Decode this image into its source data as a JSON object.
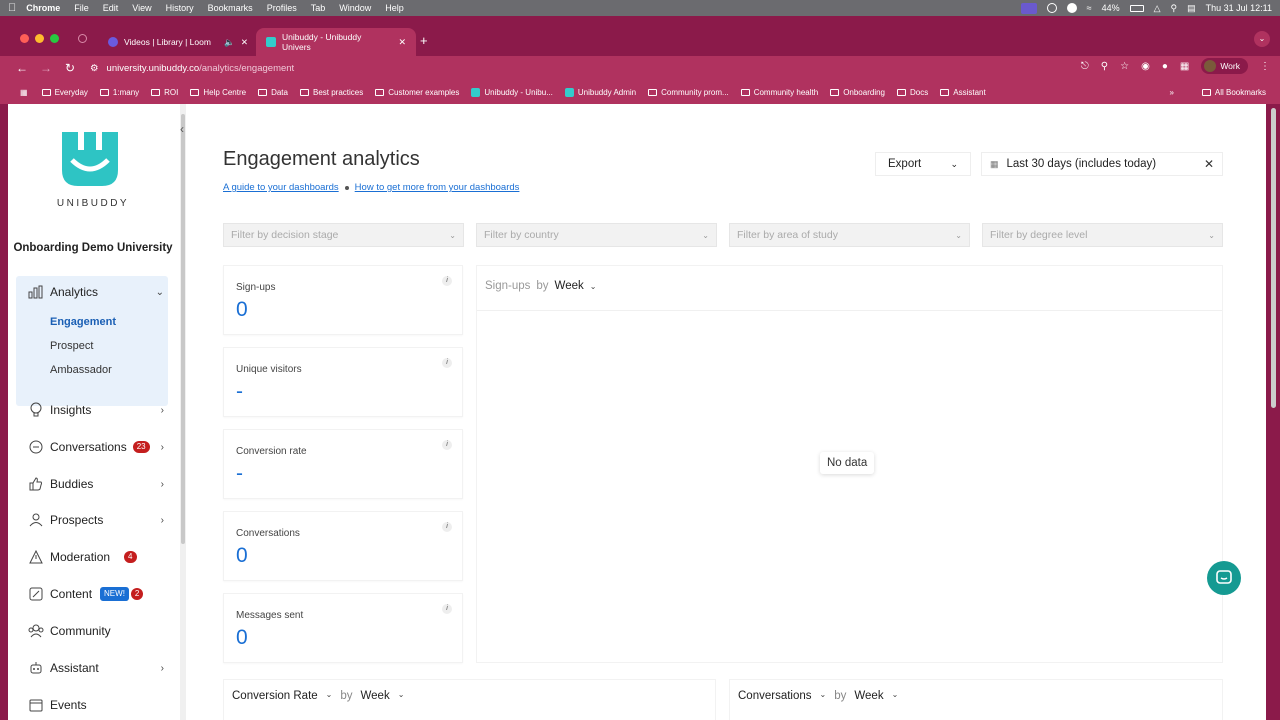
{
  "menubar": {
    "app": "Chrome",
    "items": [
      "File",
      "Edit",
      "View",
      "History",
      "Bookmarks",
      "Profiles",
      "Tab",
      "Window",
      "Help"
    ],
    "battery": "44%",
    "datetime": "Thu 31 Jul  12:11"
  },
  "tabs": [
    {
      "title": "Videos | Library | Loom",
      "active": false
    },
    {
      "title": "Unibuddy - Unibuddy Univers",
      "active": true
    }
  ],
  "toolbar": {
    "url_domain": "university.unibuddy.co",
    "url_path": "/analytics/engagement",
    "profile": "Work"
  },
  "bookmarks": {
    "items": [
      "Everyday",
      "1:many",
      "ROI",
      "Help Centre",
      "Data",
      "Best practices",
      "Customer examples",
      "Unibuddy - Unibu...",
      "Unibuddy Admin",
      "Community prom...",
      "Community health",
      "Onboarding",
      "Docs",
      "Assistant"
    ],
    "all": "All Bookmarks"
  },
  "sidebar": {
    "logo_text": "UNIBUDDY",
    "university": "Onboarding Demo University",
    "analytics": {
      "label": "Analytics",
      "sub": [
        "Engagement",
        "Prospect",
        "Ambassador"
      ]
    },
    "items": [
      {
        "label": "Insights",
        "icon": "lightbulb-icon",
        "badge": ""
      },
      {
        "label": "Conversations",
        "icon": "chat-icon",
        "badge": "23"
      },
      {
        "label": "Buddies",
        "icon": "thumbs-up-icon",
        "badge": ""
      },
      {
        "label": "Prospects",
        "icon": "person-icon",
        "badge": ""
      },
      {
        "label": "Moderation",
        "icon": "warning-icon",
        "badge": "4"
      },
      {
        "label": "Content",
        "icon": "edit-icon",
        "badge": "2",
        "tag": "NEW!"
      },
      {
        "label": "Community",
        "icon": "group-icon",
        "badge": ""
      },
      {
        "label": "Assistant",
        "icon": "robot-icon",
        "badge": ""
      },
      {
        "label": "Events",
        "icon": "calendar-icon",
        "badge": ""
      }
    ]
  },
  "main": {
    "title": "Engagement analytics",
    "link1": "A guide to your dashboards",
    "link2": "How to get more from your dashboards",
    "export": "Export",
    "date_range": "Last 30 days (includes today)",
    "filters": [
      "Filter by decision stage",
      "Filter by country",
      "Filter by area of study",
      "Filter by degree level"
    ],
    "metrics": [
      {
        "label": "Sign-ups",
        "value": "0"
      },
      {
        "label": "Unique visitors",
        "value": "-"
      },
      {
        "label": "Conversion rate",
        "value": "-"
      },
      {
        "label": "Conversations",
        "value": "0"
      },
      {
        "label": "Messages sent",
        "value": "0"
      }
    ],
    "chart": {
      "metric": "Sign-ups",
      "by": "by",
      "period": "Week",
      "empty": "No data"
    },
    "bottom_left": {
      "metric": "Conversion Rate",
      "by": "by",
      "period": "Week"
    },
    "bottom_right": {
      "metric": "Conversations",
      "by": "by",
      "period": "Week"
    }
  },
  "colors": {
    "chrome": "#8b1a4a",
    "toolbar": "#b0325f",
    "accent": "#1a6fd4",
    "brand": "#2ec4c4",
    "chat": "#159a92"
  }
}
